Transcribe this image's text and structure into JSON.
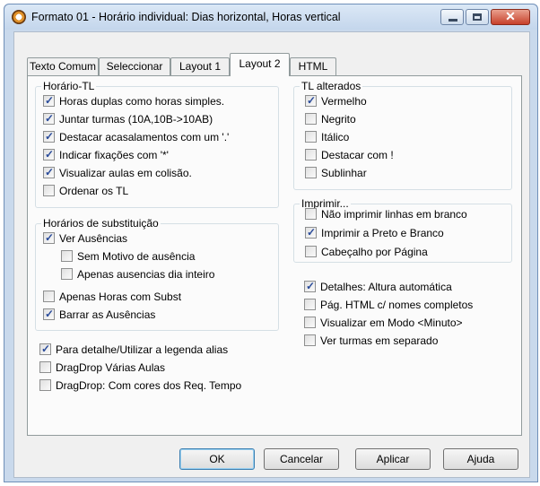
{
  "window": {
    "title": "Formato 01 - Horário individual: Dias horizontal, Horas vertical",
    "controls": {
      "minimize": "",
      "maximize": "",
      "close": "✕"
    }
  },
  "tabs": [
    {
      "label": "Texto Comum",
      "active": false
    },
    {
      "label": "Seleccionar",
      "active": false
    },
    {
      "label": "Layout 1",
      "active": false
    },
    {
      "label": "Layout 2",
      "active": true
    },
    {
      "label": "HTML",
      "active": false
    }
  ],
  "groups": {
    "horario_tl": {
      "legend": "Horário-TL",
      "items": [
        {
          "label": "Horas duplas como horas simples.",
          "checked": true
        },
        {
          "label": "Juntar turmas (10A,10B->10AB)",
          "checked": true
        },
        {
          "label": "Destacar acasalamentos com um '.'",
          "checked": true
        },
        {
          "label": "Indicar fixações com '*'",
          "checked": true
        },
        {
          "label": "Visualizar aulas em colisão.",
          "checked": true
        },
        {
          "label": "Ordenar os TL",
          "checked": false
        }
      ]
    },
    "substituicao": {
      "legend": "Horários de substituição",
      "items": [
        {
          "label": "Ver Ausências",
          "checked": true
        },
        {
          "label": "Sem Motivo de ausência",
          "checked": false
        },
        {
          "label": "Apenas ausencias dia inteiro",
          "checked": false
        },
        {
          "label": "Apenas Horas com Subst",
          "checked": false
        },
        {
          "label": "Barrar as Ausências",
          "checked": true
        }
      ]
    },
    "tl_alterados": {
      "legend": "TL alterados",
      "items": [
        {
          "label": "Vermelho",
          "checked": true
        },
        {
          "label": "Negrito",
          "checked": false
        },
        {
          "label": "Itálico",
          "checked": false
        },
        {
          "label": "Destacar com  !",
          "checked": false
        },
        {
          "label": "Sublinhar",
          "checked": false
        }
      ]
    },
    "imprimir": {
      "legend": "Imprimir...",
      "items": [
        {
          "label": "Não imprimir linhas em branco",
          "checked": false
        },
        {
          "label": "Imprimir a Preto e Branco",
          "checked": true
        },
        {
          "label": "Cabeçalho por Página",
          "checked": false
        }
      ]
    }
  },
  "loose_left": [
    {
      "label": "Para detalhe/Utilizar a legenda alias",
      "checked": true
    },
    {
      "label": "DragDrop  Várias Aulas",
      "checked": false
    },
    {
      "label": "DragDrop: Com cores dos Req. Tempo",
      "checked": false
    }
  ],
  "loose_right": [
    {
      "label": "Detalhes: Altura automática",
      "checked": true
    },
    {
      "label": "Pág. HTML c/ nomes completos",
      "checked": false
    },
    {
      "label": "Visualizar em Modo <Minuto>",
      "checked": false
    },
    {
      "label": "Ver turmas em separado",
      "checked": false
    }
  ],
  "buttons": {
    "ok": "OK",
    "cancel": "Cancelar",
    "apply": "Aplicar",
    "help": "Ajuda"
  },
  "check_glyph": "✓"
}
